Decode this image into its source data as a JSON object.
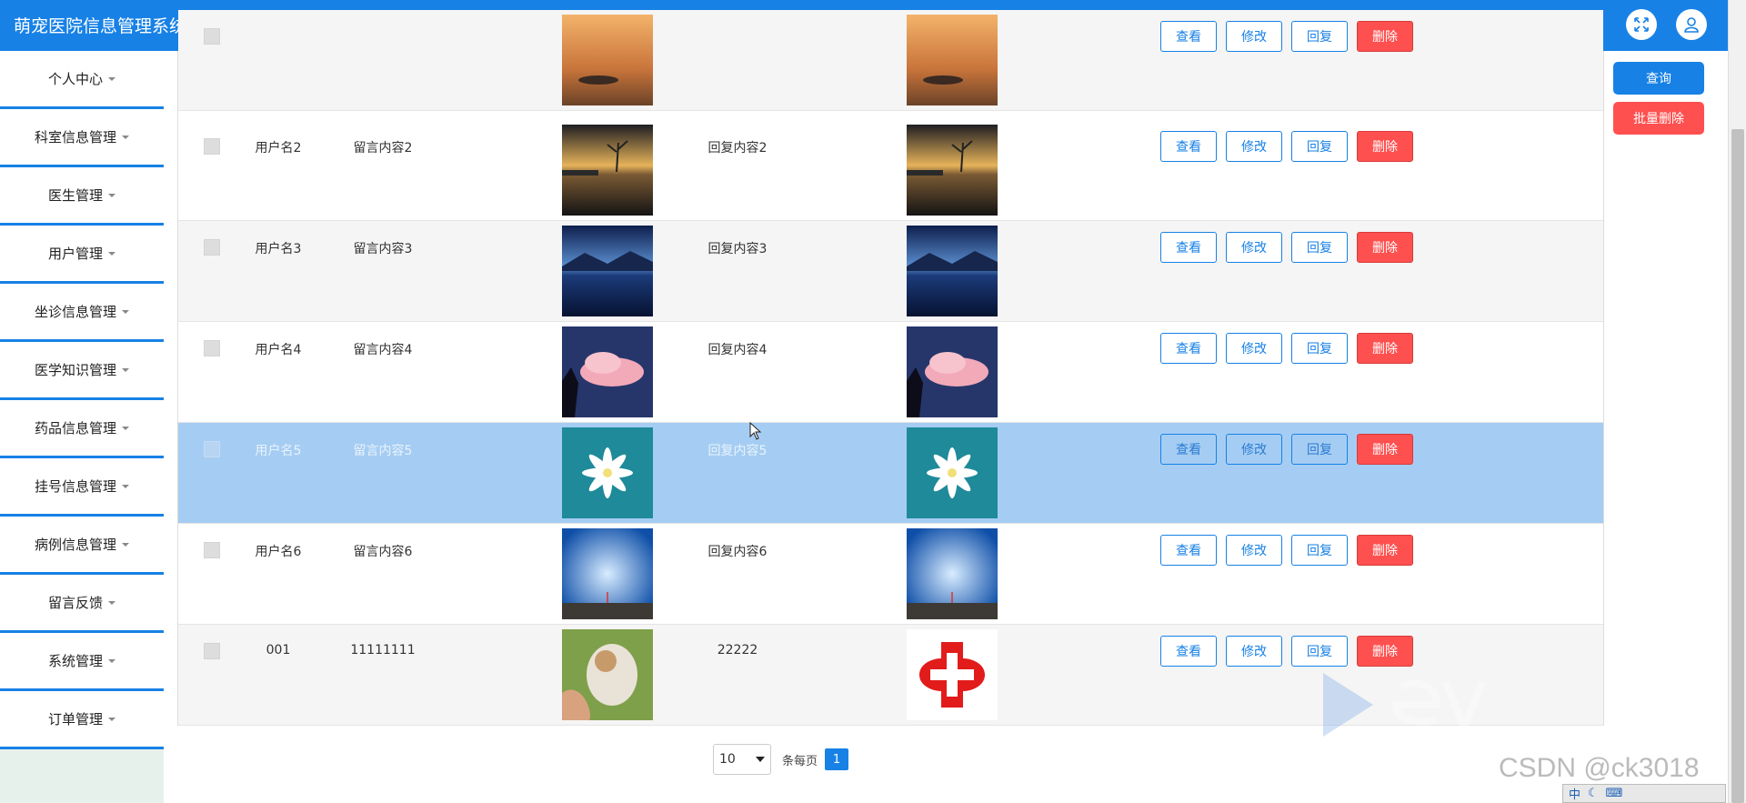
{
  "app": {
    "title": "萌宠医院信息管理系统"
  },
  "header": {
    "fullscreen_icon": "fullscreen-icon",
    "user_icon": "user-icon"
  },
  "sidebar": {
    "items": [
      {
        "label": "个人中心"
      },
      {
        "label": "科室信息管理"
      },
      {
        "label": "医生管理"
      },
      {
        "label": "用户管理"
      },
      {
        "label": "坐诊信息管理"
      },
      {
        "label": "医学知识管理"
      },
      {
        "label": "药品信息管理"
      },
      {
        "label": "挂号信息管理"
      },
      {
        "label": "病例信息管理"
      },
      {
        "label": "留言反馈"
      },
      {
        "label": "系统管理"
      },
      {
        "label": "订单管理"
      }
    ]
  },
  "actions": {
    "query_label": "查询",
    "batch_delete_label": "批量删除"
  },
  "row_buttons": {
    "view": "查看",
    "edit": "修改",
    "reply": "回复",
    "delete": "删除"
  },
  "table": {
    "rows": [
      {
        "username": "",
        "message": "",
        "reply": "",
        "image": "sunset",
        "reply_image": "sunset"
      },
      {
        "username": "用户名2",
        "message": "留言内容2",
        "reply": "回复内容2",
        "image": "lake-tree",
        "reply_image": "lake-tree"
      },
      {
        "username": "用户名3",
        "message": "留言内容3",
        "reply": "回复内容3",
        "image": "night-lake",
        "reply_image": "night-lake"
      },
      {
        "username": "用户名4",
        "message": "留言内容4",
        "reply": "回复内容4",
        "image": "pink-clouds",
        "reply_image": "pink-clouds"
      },
      {
        "username": "用户名5",
        "message": "留言内容5",
        "reply": "回复内容5",
        "image": "white-flower",
        "reply_image": "white-flower"
      },
      {
        "username": "用户名6",
        "message": "留言内容6",
        "reply": "回复内容6",
        "image": "blue-sky",
        "reply_image": "blue-sky"
      },
      {
        "username": "001",
        "message": "11111111",
        "reply": "22222",
        "image": "cat",
        "reply_image": "red-cross"
      }
    ]
  },
  "pagination": {
    "page_size": "10",
    "per_page_label": "条每页",
    "current_page": "1"
  },
  "watermark": {
    "csdn": "CSDN @ck3018"
  },
  "taskbar": {
    "ime": "中"
  }
}
